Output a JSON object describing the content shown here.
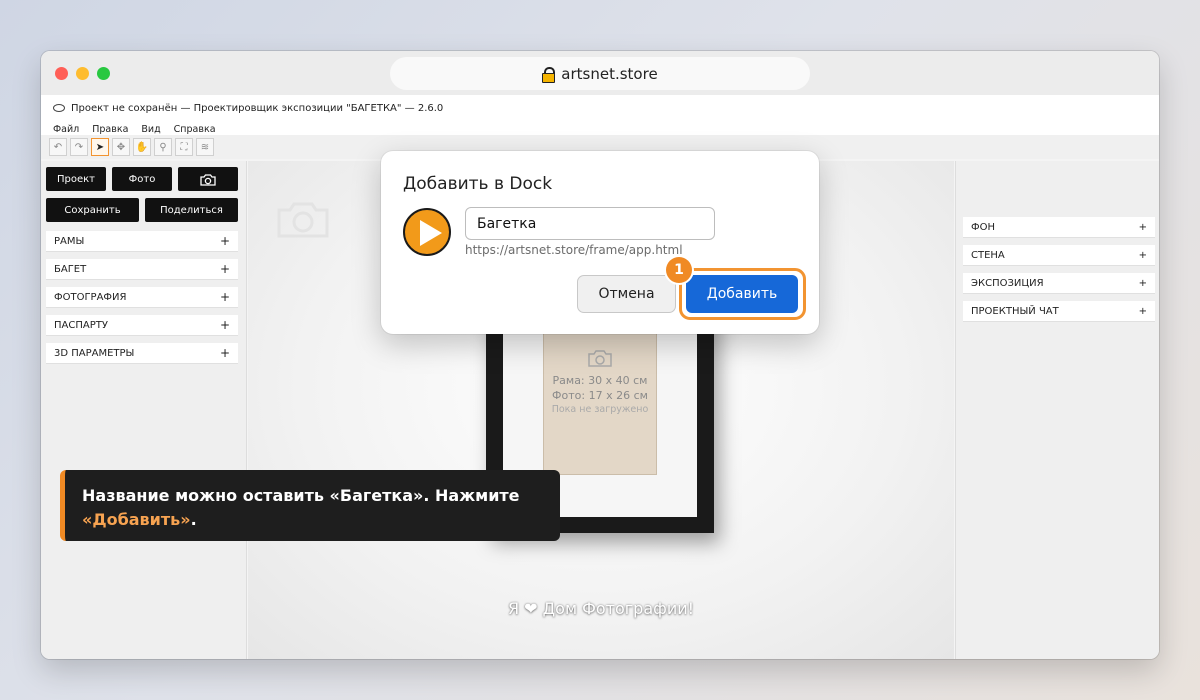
{
  "browser": {
    "url": "artsnet.store",
    "traffic_lights": {
      "close": "#ff5f57",
      "minimize": "#febc2e",
      "zoom": "#28c840"
    }
  },
  "app": {
    "title": "Проект не сохранён — Проектировщик экспозиции \"БАГЕТКА\"  — 2.6.0",
    "menu": [
      "Файл",
      "Правка",
      "Вид",
      "Справка"
    ],
    "toolbar_icons": [
      "undo-icon",
      "redo-icon",
      "select-icon",
      "move-icon",
      "hand-icon",
      "magic-wand-icon",
      "fullscreen-icon",
      "layers-icon"
    ]
  },
  "left_panel": {
    "buttons": {
      "project": "Проект",
      "photo": "Фото",
      "save": "Сохранить",
      "share": "Поделиться"
    },
    "sections": [
      "РАМЫ",
      "БАГЕТ",
      "ФОТОГРАФИЯ",
      "ПАСПАРТУ",
      "3D ПАРАМЕТРЫ"
    ],
    "plus": "+"
  },
  "right_panel": {
    "sections": [
      "ФОН",
      "СТЕНА",
      "ЭКСПОЗИЦИЯ",
      "ПРОЕКТНЫЙ ЧАТ"
    ],
    "plus": "+"
  },
  "canvas": {
    "frame_size": "Рама: 30 x 40 см",
    "photo_size": "Фото: 17 x 26 см",
    "photo_status": "Пока не загружено",
    "slogan": "Я ❤ Дом Фотографии!"
  },
  "dialog": {
    "title": "Добавить в Dock",
    "name_value": "Багетка",
    "url": "https://artsnet.store/frame/app.html",
    "cancel_label": "Отмена",
    "add_label": "Добавить",
    "accent_color": "#1668d8"
  },
  "tutorial": {
    "step_number": "1",
    "text_before": "Название можно оставить «Багетка». Нажмите ",
    "text_highlight": "«Добавить»",
    "text_after": ".",
    "accent_color": "#f08a24"
  }
}
